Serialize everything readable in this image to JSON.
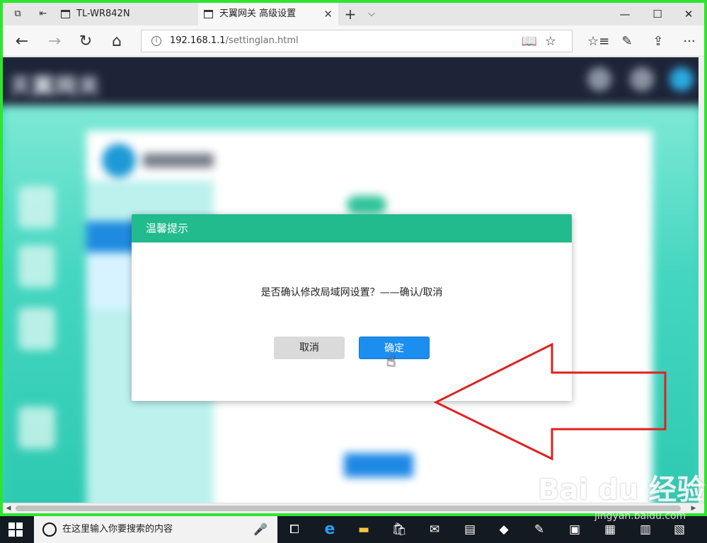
{
  "browser": {
    "tabs": [
      {
        "label": "TL-WR842N"
      },
      {
        "label": "天翼网关 高级设置"
      }
    ],
    "new_tab": "+",
    "tab_list": "⌵",
    "window": {
      "minimize": "—",
      "maximize": "☐",
      "close": "✕"
    },
    "url_host": "192.168.1.1",
    "url_path": "/settinglan.html",
    "nav": {
      "back": "←",
      "forward": "→",
      "refresh": "↻",
      "home": "⌂"
    },
    "tools": {
      "reading": "📖",
      "favorite": "☆",
      "favorites_list": "☆≡",
      "notes": "✎",
      "share": "⇪",
      "more": "···"
    }
  },
  "dialog": {
    "title": "温馨提示",
    "message": "是否确认修改局域网设置？——确认/取消",
    "cancel_label": "取消",
    "ok_label": "确定"
  },
  "taskbar": {
    "search_placeholder": "在这里输入你要搜索的内容",
    "apps": [
      "task-view",
      "edge",
      "file-explorer",
      "store",
      "mail",
      "app-1",
      "app-2",
      "app-3",
      "app-4",
      "app-5",
      "app-6"
    ]
  },
  "watermark": {
    "brand": "Bai du 经验",
    "site": "jingyan.baidu.com"
  },
  "colors": {
    "dialog_header": "#22bb8e",
    "ok_button": "#1c8ef0",
    "cancel_button": "#dadada",
    "highlight_border": "#2ee52e",
    "arrow": "#e02020"
  }
}
